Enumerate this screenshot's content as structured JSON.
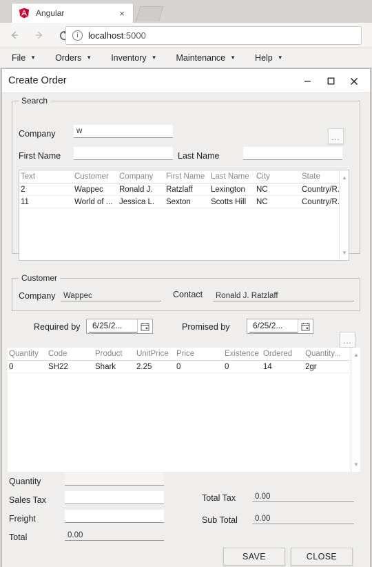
{
  "browser": {
    "tab": {
      "title": "Angular",
      "favicon": "angular-logo-icon",
      "close": "×"
    },
    "nav": {
      "back": "←",
      "forward": "→",
      "reload": "⟳"
    },
    "omnibox": {
      "info_icon": "i",
      "url_host": "localhost",
      "url_port": ":5000"
    }
  },
  "menubar": {
    "items": [
      {
        "label": "File",
        "caret": "▼"
      },
      {
        "label": "Orders",
        "caret": "▼"
      },
      {
        "label": "Inventory",
        "caret": "▼"
      },
      {
        "label": "Maintenance",
        "caret": "▼"
      },
      {
        "label": "Help",
        "caret": "▼"
      }
    ]
  },
  "dialog": {
    "title": "Create Order",
    "controls": {
      "minimize": "–",
      "maximize": "☐",
      "close": "✕"
    },
    "search": {
      "legend": "Search",
      "company_label": "Company",
      "company_value": "w",
      "first_name_label": "First Name",
      "first_name_value": "",
      "last_name_label": "Last Name",
      "last_name_value": "",
      "browse_button": "...",
      "grid": {
        "columns": [
          "Text",
          "Customer",
          "Company",
          "First Name",
          "Last Name",
          "City",
          "State"
        ],
        "rows": [
          [
            "2",
            "Wappec",
            "Ronald J.",
            "Ratzlaff",
            "Lexington",
            "NC",
            "Country/R..."
          ],
          [
            "11",
            "World of ...",
            "Jessica L.",
            "Sexton",
            "Scotts Hill",
            "NC",
            "Country/R..."
          ]
        ],
        "scroll_up": "▲",
        "scroll_down": "▼"
      }
    },
    "customer": {
      "legend": "Customer",
      "company_label": "Company",
      "company_value": "Wappec",
      "contact_label": "Contact",
      "contact_value": "Ronald J. Ratzlaff"
    },
    "dates": {
      "required_by_label": "Required by",
      "required_by_value": "6/25/2...",
      "promised_by_label": "Promised by",
      "promised_by_value": "6/25/2...",
      "calendar_icon": "calendar-icon"
    },
    "items": {
      "browse_button": "...",
      "grid": {
        "columns": [
          "Quantity",
          "Code",
          "Product",
          "UnitPrice",
          "Price",
          "Existence",
          "Ordered",
          "Quantity..."
        ],
        "rows": [
          [
            "0",
            "SH22",
            "Shark",
            "2.25",
            "0",
            "0",
            "14",
            "2gr"
          ]
        ],
        "scroll_up": "▲",
        "scroll_down": "▼"
      }
    },
    "totals": {
      "quantity_label": "Quantity",
      "quantity_value": "",
      "sales_tax_label": "Sales Tax",
      "sales_tax_value": "",
      "freight_label": "Freight",
      "freight_value": "",
      "total_label": "Total",
      "total_value": "0.00",
      "total_tax_label": "Total Tax",
      "total_tax_value": "0.00",
      "sub_total_label": "Sub Total",
      "sub_total_value": "0.00"
    },
    "actions": {
      "save": "SAVE",
      "close": "CLOSE"
    }
  },
  "colors": {
    "dialog_bg": "#efeeec",
    "chrome_bg": "#d6d3d0",
    "angular_red": "#dd0031",
    "grid_header_text": "#8a8885"
  }
}
